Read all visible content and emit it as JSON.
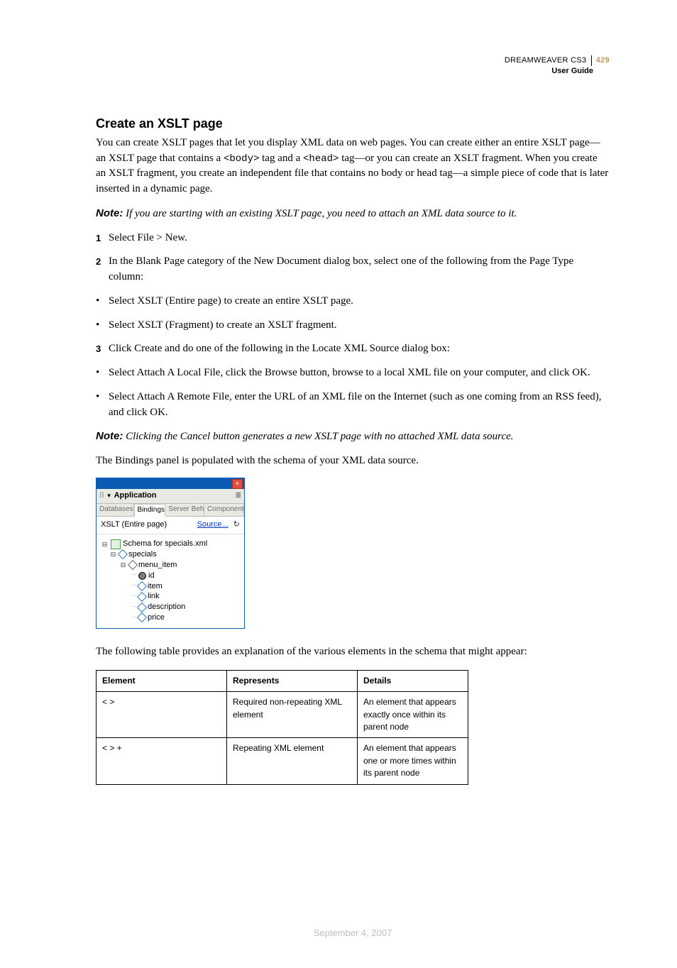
{
  "header": {
    "product": "DREAMWEAVER CS3",
    "page_num": "429",
    "subtitle": "User Guide"
  },
  "title": "Create an XSLT page",
  "intro_parts": {
    "a": "You can create XSLT pages that let you display XML data on web pages. You can create either an entire XSLT page—an XSLT page that contains a ",
    "b": " tag and a ",
    "c": " tag—or you can create an XSLT fragment. When you create an XSLT fragment, you create an independent file that contains no body or head tag—a simple piece of code that is later inserted in a dynamic page.",
    "tag1": "<body>",
    "tag2": "<head>"
  },
  "note1": {
    "label": "Note:",
    "text": " If you are starting with an existing XSLT page, you need to attach an XML data source to it."
  },
  "steps": {
    "s1": "Select File > New.",
    "s2": "In the Blank Page category of the New Document dialog box, select one of the following from the Page Type column:",
    "s3": "Click Create and do one of the following in the Locate XML Source dialog box:"
  },
  "bullets": {
    "b1": "Select XSLT (Entire page) to create an entire XSLT page.",
    "b2": "Select XSLT (Fragment) to create an XSLT fragment.",
    "b3": "Select Attach A Local File, click the Browse button, browse to a local XML file on your computer, and click OK.",
    "b4": "Select Attach A Remote File, enter the URL of an XML file on the Internet (such as one coming from an RSS feed), and click OK."
  },
  "note2": {
    "label": "Note:",
    "text": " Clicking the Cancel button generates a new XSLT page with no attached XML data source."
  },
  "after_panel": "The Bindings panel is populated with the schema of your XML data source.",
  "panel": {
    "app_label": "Application",
    "tabs": {
      "db": "Databases",
      "bind": "Bindings",
      "serv": "Server Beh",
      "comp": "Component"
    },
    "type_label": "XSLT (Entire page)",
    "source_link": "Source...",
    "tree": {
      "root": "Schema for specials.xml",
      "n1": "specials",
      "n2": "menu_item",
      "a1": "id",
      "c1": "item",
      "c2": "link",
      "c3": "description",
      "c4": "price"
    }
  },
  "caption": "The following table provides an explanation of the various elements in the schema that might appear:",
  "table": {
    "h1": "Element",
    "h2": "Represents",
    "h3": "Details",
    "r1c1": "< >",
    "r1c2": "Required non-repeating XML element",
    "r1c3": "An element that appears exactly once within its parent node",
    "r2c1": "< > +",
    "r2c2": "Repeating XML element",
    "r2c3": "An element that appears one or more times within its parent node"
  },
  "footer_date": "September 4, 2007"
}
